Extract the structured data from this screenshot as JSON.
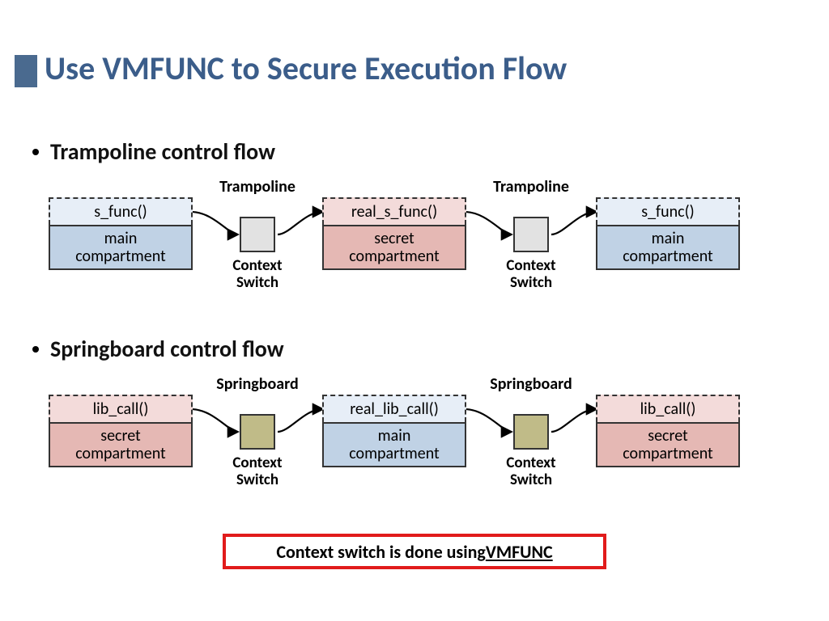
{
  "title": "Use VMFUNC to Secure Execution Flow",
  "bullets": {
    "trampoline": "Trampoline control flow",
    "springboard": "Springboard control flow"
  },
  "labels": {
    "trampoline": "Trampoline",
    "springboard": "Springboard",
    "context_switch": "Context\nSwitch"
  },
  "trampoline_flow": {
    "left": {
      "top": "s_func()",
      "bottom": "main\ncompartment"
    },
    "center": {
      "top": "real_s_func()",
      "bottom": "secret\ncompartment"
    },
    "right": {
      "top": "s_func()",
      "bottom": "main\ncompartment"
    }
  },
  "springboard_flow": {
    "left": {
      "top": "lib_call()",
      "bottom": "secret\ncompartment"
    },
    "center": {
      "top": "real_lib_call()",
      "bottom": "main\ncompartment"
    },
    "right": {
      "top": "lib_call()",
      "bottom": "secret\ncompartment"
    }
  },
  "callout_prefix": "Context switch is done using ",
  "callout_emph": "VMFUNC"
}
